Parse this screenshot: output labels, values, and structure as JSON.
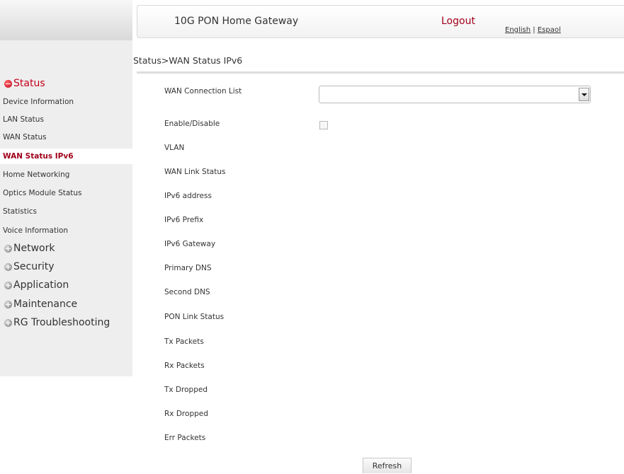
{
  "header": {
    "title": "10G PON Home Gateway",
    "logout_label": "Logout",
    "lang_english": "English",
    "lang_separator": " | ",
    "lang_spanish": "Espaol"
  },
  "breadcrumb": "Status>WAN Status IPv6",
  "sidebar": {
    "groups": [
      {
        "label": "Status",
        "state": "expanded",
        "icon": "minus-icon"
      },
      {
        "label": "Network",
        "state": "collapsed",
        "icon": "plus-icon"
      },
      {
        "label": "Security",
        "state": "collapsed",
        "icon": "plus-icon"
      },
      {
        "label": "Application",
        "state": "collapsed",
        "icon": "plus-icon"
      },
      {
        "label": "Maintenance",
        "state": "collapsed",
        "icon": "plus-icon"
      },
      {
        "label": "RG Troubleshooting",
        "state": "collapsed",
        "icon": "plus-icon"
      }
    ],
    "status_items": [
      {
        "label": "Device Information"
      },
      {
        "label": "LAN Status"
      },
      {
        "label": "WAN Status"
      },
      {
        "label": "WAN Status IPv6",
        "selected": true
      },
      {
        "label": "Home Networking"
      },
      {
        "label": "Optics Module Status"
      },
      {
        "label": "Statistics"
      },
      {
        "label": "Voice Information"
      }
    ]
  },
  "form": {
    "fields": [
      {
        "label": "WAN Connection List",
        "value": ""
      },
      {
        "label": "Enable/Disable",
        "checked": false
      },
      {
        "label": "VLAN",
        "value": ""
      },
      {
        "label": "WAN Link Status",
        "value": ""
      },
      {
        "label": "IPv6 address",
        "value": ""
      },
      {
        "label": "IPv6 Prefix",
        "value": ""
      },
      {
        "label": "IPv6 Gateway",
        "value": ""
      },
      {
        "label": "Primary DNS",
        "value": ""
      },
      {
        "label": "Second DNS",
        "value": ""
      },
      {
        "label": "PON Link Status",
        "value": ""
      },
      {
        "label": "Tx Packets",
        "value": ""
      },
      {
        "label": "Rx Packets",
        "value": ""
      },
      {
        "label": "Tx Dropped",
        "value": ""
      },
      {
        "label": "Rx Dropped",
        "value": ""
      },
      {
        "label": "Err Packets",
        "value": ""
      }
    ],
    "refresh_label": "Refresh"
  },
  "colors": {
    "accent": "#a0001a",
    "active_group": "#c4001a",
    "sidebar_bg": "#eeeeee"
  }
}
